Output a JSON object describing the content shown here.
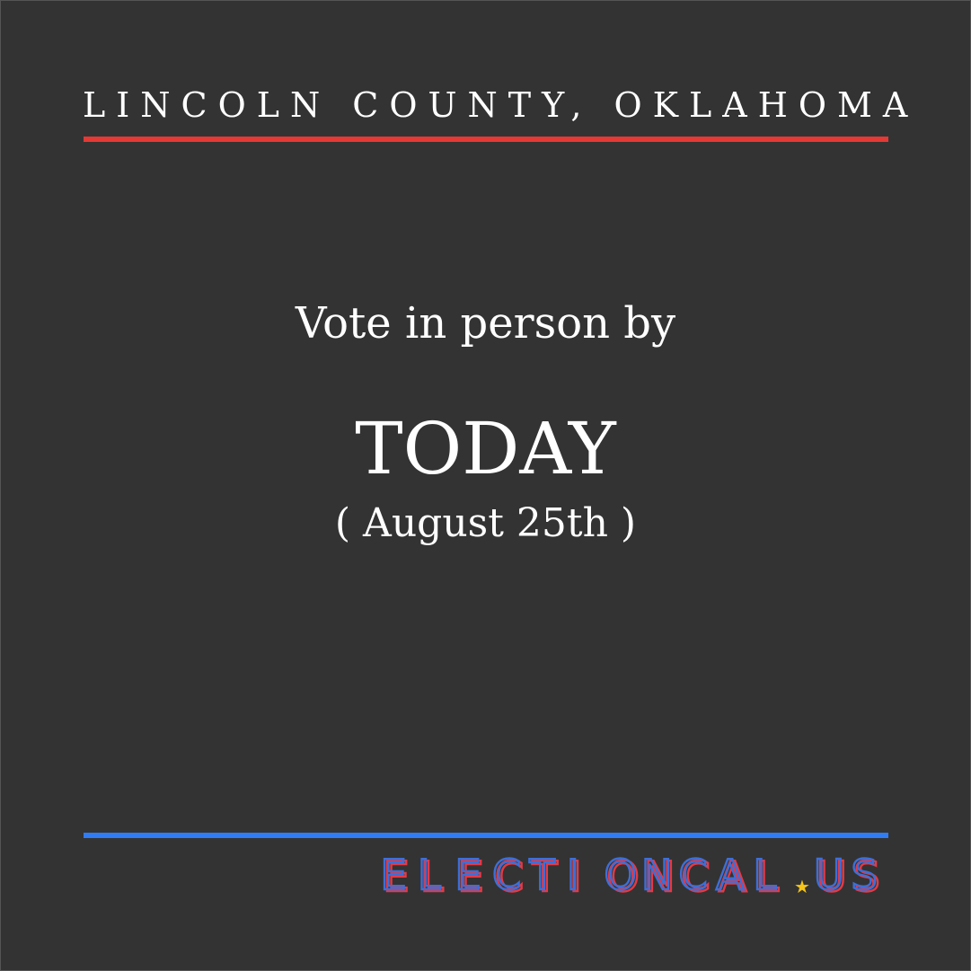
{
  "header": {
    "county": "LINCOLN COUNTY, OKLAHOMA"
  },
  "message": {
    "lead": "Vote in person by",
    "deadline": "TODAY",
    "date": "( August 25th )"
  },
  "brand": {
    "text": "ELECTIONCAL.US",
    "star_icon": "star-icon"
  },
  "colors": {
    "background": "#333333",
    "top_rule": "#e53935",
    "bottom_rule": "#2f7cf6",
    "brand_red": "#e53945",
    "brand_blue": "#3d6fd8",
    "star": "#f5c518"
  }
}
